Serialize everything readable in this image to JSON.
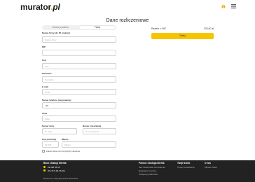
{
  "header": {
    "logo_main": "murator",
    "logo_dot": ".",
    "logo_suffix": "pl"
  },
  "page_title": "Dane rozliczeniowe",
  "tabs": [
    {
      "label": "Osoba prywatna"
    },
    {
      "label": "Firma"
    }
  ],
  "form": {
    "company_name": {
      "label": "Nazwa firmy (do 50 znaków)",
      "placeholder": "Nazwa firmy"
    },
    "nip": {
      "label": "NIP",
      "placeholder": ""
    },
    "city": {
      "label": "Kraj",
      "placeholder": "Kraj"
    },
    "surname": {
      "label": "Nazwisko",
      "placeholder": "Nazwisko"
    },
    "email": {
      "label": "E-mail",
      "placeholder": "Email"
    },
    "phone": {
      "label": "Numer telefonu (opcjonalnie)",
      "placeholder": "+48"
    },
    "street": {
      "label": "Ulica",
      "placeholder": "Ulica"
    },
    "house_no": {
      "label": "Numer ulicy",
      "placeholder": "Nr ulicy"
    },
    "flat_no": {
      "label": "Numer mieszkania",
      "placeholder": "Nr mieszkania"
    },
    "postal": {
      "label": "Kod pocztowy",
      "placeholder": "00-000"
    },
    "town": {
      "label": "Miasto",
      "placeholder": "Miasto"
    },
    "checkbox_label": "Zapisz dane do przyszłych zakupów"
  },
  "summary": {
    "label": "Razem z VAT",
    "value": "233,00 zł",
    "pay_button": "Dalej"
  },
  "footer": {
    "col1_head": "Biuro Obsługi Klienta",
    "phone": "22 590 55 55",
    "phone2": "(Pn-Pt 8.00-16.00)",
    "copyright": "Murator SA • Wszystkie prawa zastrzeżone",
    "col2_head": "Pomoc i obsługa klienta",
    "col2_items": [
      "Jak zrealizować zamówienie",
      "Regulamin serwisu",
      "Polityka prywatności"
    ],
    "col3_head": "Twoje konto",
    "col3_items": [
      "Twoje zamówienia"
    ],
    "col4_head": "O nas",
    "col4_items": [
      "Murator Nasz"
    ]
  },
  "colors": {
    "accent": "#f7c500",
    "footer_bg": "#222222"
  }
}
